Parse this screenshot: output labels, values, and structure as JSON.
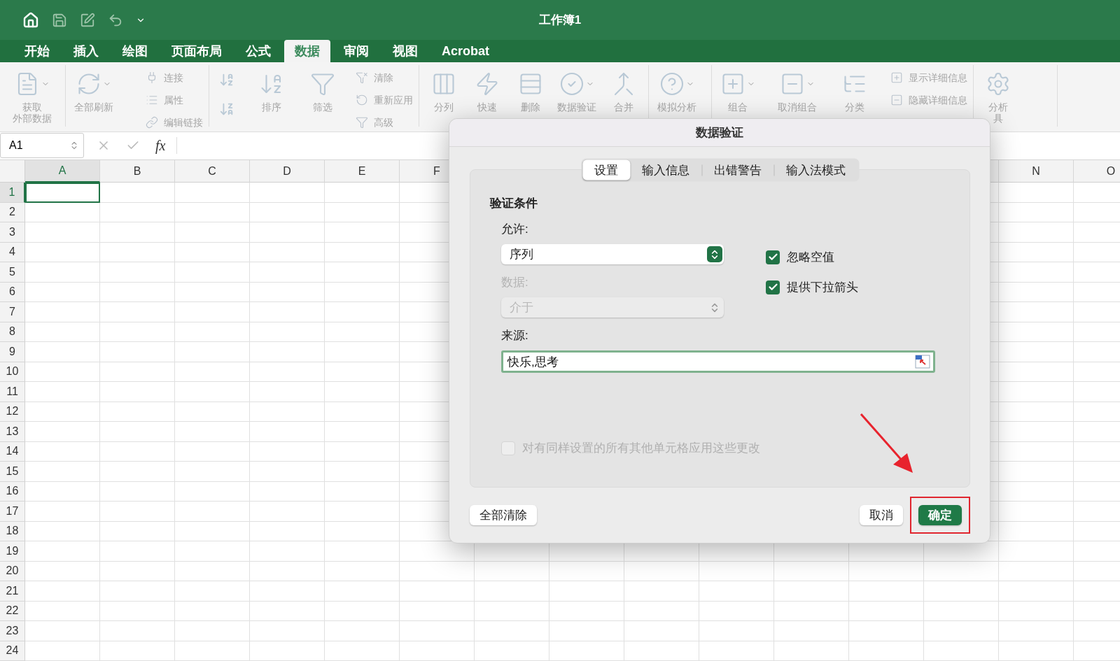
{
  "window": {
    "title": "工作簿1"
  },
  "tabs": [
    {
      "label": "开始",
      "selected": false
    },
    {
      "label": "插入",
      "selected": false
    },
    {
      "label": "绘图",
      "selected": false
    },
    {
      "label": "页面布局",
      "selected": false
    },
    {
      "label": "公式",
      "selected": false
    },
    {
      "label": "数据",
      "selected": true
    },
    {
      "label": "审阅",
      "selected": false
    },
    {
      "label": "视图",
      "selected": false
    },
    {
      "label": "Acrobat",
      "selected": false
    }
  ],
  "ribbon": {
    "groups": [
      {
        "items": [
          {
            "kind": "large",
            "lines": [
              "获取",
              "外部数据"
            ],
            "dropdown": true
          }
        ]
      },
      {
        "items": [
          {
            "kind": "large",
            "lines": [
              "全部刷新"
            ],
            "dropdown": true
          },
          {
            "kind": "stack",
            "items": [
              {
                "label": "连接"
              },
              {
                "label": "属性"
              },
              {
                "label": "编辑链接"
              }
            ]
          }
        ]
      },
      {
        "items": [
          {
            "kind": "sort_buttons"
          },
          {
            "kind": "large",
            "lines": [
              "排序"
            ],
            "dropdown": false
          },
          {
            "kind": "large",
            "lines": [
              "筛选"
            ],
            "dropdown": false
          },
          {
            "kind": "stack",
            "items": [
              {
                "label": "清除"
              },
              {
                "label": "重新应用"
              },
              {
                "label": "高级"
              }
            ]
          }
        ]
      },
      {
        "items": [
          {
            "kind": "large",
            "lines": [
              "分列"
            ],
            "dropdown": false
          },
          {
            "kind": "large",
            "lines": [
              "快速"
            ],
            "dropdown": false
          },
          {
            "kind": "large",
            "lines": [
              "删除"
            ],
            "dropdown": false
          },
          {
            "kind": "large",
            "lines": [
              "数据验证"
            ],
            "dropdown": true
          },
          {
            "kind": "large",
            "lines": [
              "合并"
            ],
            "dropdown": false
          }
        ]
      },
      {
        "items": [
          {
            "kind": "large",
            "lines": [
              "模拟分析"
            ],
            "dropdown": true
          }
        ]
      },
      {
        "items": [
          {
            "kind": "large",
            "lines": [
              "组合"
            ],
            "dropdown": true
          },
          {
            "kind": "large",
            "lines": [
              "取消组合"
            ],
            "dropdown": true
          },
          {
            "kind": "large",
            "lines": [
              "分类"
            ],
            "dropdown": false
          },
          {
            "kind": "stack",
            "items": [
              {
                "label": "显示详细信息"
              },
              {
                "label": "隐藏详细信息"
              }
            ]
          }
        ]
      },
      {
        "items": [
          {
            "kind": "large",
            "lines": [
              "分析",
              "具"
            ],
            "dropdown": false
          }
        ]
      }
    ]
  },
  "formula_bar": {
    "name_box": "A1",
    "fx": "fx"
  },
  "sheet": {
    "columns": [
      {
        "label": "A",
        "selected": true
      },
      {
        "label": "B",
        "selected": false
      },
      {
        "label": "C",
        "selected": false
      },
      {
        "label": "D",
        "selected": false
      },
      {
        "label": "E",
        "selected": false
      },
      {
        "label": "F",
        "selected": false
      },
      {
        "label": "N",
        "selected": false
      },
      {
        "label": "O",
        "selected": false
      }
    ],
    "rows": [
      {
        "label": "1",
        "selected": true
      },
      {
        "label": "2",
        "selected": false
      },
      {
        "label": "3",
        "selected": false
      },
      {
        "label": "4",
        "selected": false
      },
      {
        "label": "5",
        "selected": false
      },
      {
        "label": "6",
        "selected": false
      },
      {
        "label": "7",
        "selected": false
      },
      {
        "label": "8",
        "selected": false
      },
      {
        "label": "9",
        "selected": false
      },
      {
        "label": "10",
        "selected": false
      },
      {
        "label": "11",
        "selected": false
      },
      {
        "label": "12",
        "selected": false
      },
      {
        "label": "13",
        "selected": false
      },
      {
        "label": "14",
        "selected": false
      },
      {
        "label": "15",
        "selected": false
      },
      {
        "label": "16",
        "selected": false
      },
      {
        "label": "17",
        "selected": false
      },
      {
        "label": "18",
        "selected": false
      },
      {
        "label": "19",
        "selected": false
      },
      {
        "label": "20",
        "selected": false
      },
      {
        "label": "21",
        "selected": false
      },
      {
        "label": "22",
        "selected": false
      },
      {
        "label": "23",
        "selected": false
      },
      {
        "label": "24",
        "selected": false
      }
    ]
  },
  "dialog": {
    "title": "数据验证",
    "tabs": [
      {
        "label": "设置",
        "selected": true
      },
      {
        "label": "输入信息",
        "selected": false
      },
      {
        "label": "出错警告",
        "selected": false
      },
      {
        "label": "输入法模式",
        "selected": false
      }
    ],
    "section_title": "验证条件",
    "allow": {
      "label": "允许:",
      "value": "序列",
      "disabled": false
    },
    "data": {
      "label": "数据:",
      "value": "介于",
      "disabled": true
    },
    "options": [
      {
        "label": "忽略空值",
        "checked": true
      },
      {
        "label": "提供下拉箭头",
        "checked": true
      }
    ],
    "source": {
      "label": "来源:",
      "value": "快乐,思考",
      "focused": true
    },
    "apply_all": {
      "label": "对有同样设置的所有其他单元格应用这些更改",
      "checked": false,
      "disabled": true
    },
    "left_buttons": [
      {
        "label": "全部清除",
        "primary": false,
        "highlighted": false
      }
    ],
    "right_buttons": [
      {
        "label": "取消",
        "primary": false,
        "highlighted": false
      },
      {
        "label": "确定",
        "primary": true,
        "highlighted": true
      }
    ]
  }
}
